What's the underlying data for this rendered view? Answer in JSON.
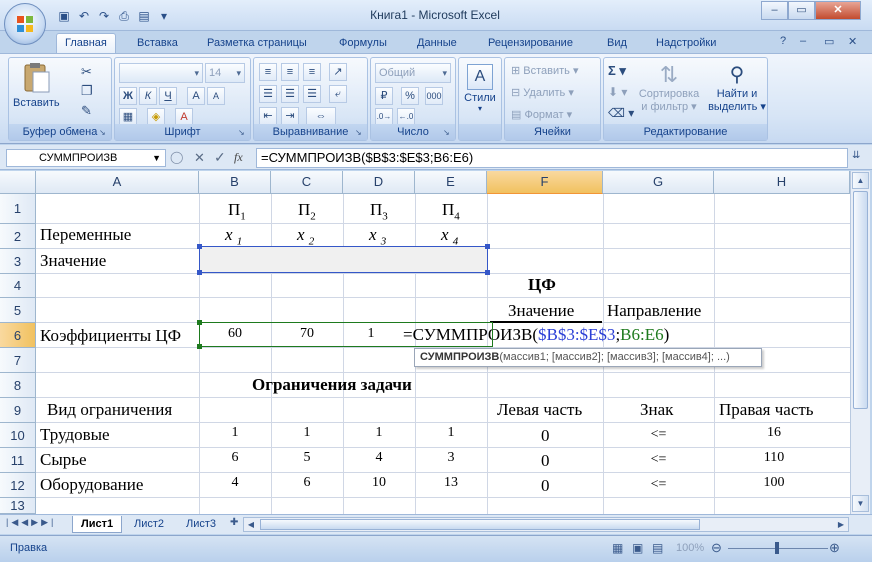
{
  "window": {
    "title": "Книга1 - Microsoft Excel"
  },
  "tabs": [
    "Главная",
    "Вставка",
    "Разметка страницы",
    "Формулы",
    "Данные",
    "Рецензирование",
    "Вид",
    "Надстройки"
  ],
  "ribbon": {
    "clipboard": {
      "label": "Буфер обмена",
      "paste": "Вставить"
    },
    "font": {
      "label": "Шрифт",
      "size": "14",
      "bold": "Ж",
      "italic": "К",
      "underline": "Ч"
    },
    "alignment": {
      "label": "Выравнивание"
    },
    "number": {
      "label": "Число",
      "format": "Общий"
    },
    "styles": {
      "label": "Стили"
    },
    "cells": {
      "label": "Ячейки",
      "insert": "Вставить",
      "delete": "Удалить",
      "format": "Формат"
    },
    "editing": {
      "label": "Редактирование",
      "sort": "Сортировка",
      "sort2": "и фильтр",
      "find": "Найти и",
      "find2": "выделить"
    }
  },
  "formula_bar": {
    "name_box": "СУММПРОИЗВ",
    "fx": "fx",
    "formula": "=СУММПРОИЗВ($B$3:$E$3;B6:E6)"
  },
  "columns": [
    "A",
    "B",
    "C",
    "D",
    "E",
    "F",
    "G",
    "H"
  ],
  "rows": [
    "1",
    "2",
    "3",
    "4",
    "5",
    "6",
    "7",
    "8",
    "9",
    "10",
    "11",
    "12",
    "13"
  ],
  "cells": {
    "B1": "П",
    "B1s": "1",
    "C1": "П",
    "C1s": "2",
    "D1": "П",
    "D1s": "3",
    "E1": "П",
    "E1s": "4",
    "A2": "Переменные",
    "B2": "x",
    "B2s": "1",
    "C2": "x",
    "C2s": "2",
    "D2": "x",
    "D2s": "3",
    "E2": "x",
    "E2s": "4",
    "A3": "Значение",
    "F4": "ЦФ",
    "F5": "Значение",
    "G5": "Направление",
    "A6": "Коэффициенты ЦФ",
    "B6": "60",
    "C6": "70",
    "D6": "1",
    "F6_prefix": "=СУММПРОИЗВ(",
    "F6_range1": "$B$3:$E$3",
    "F6_sep": ";",
    "F6_range2": "B6:E6",
    "F6_suffix": ")",
    "D8": "Ограничения задачи",
    "A9": "Вид ограничения",
    "F9": "Левая часть",
    "G9": "Знак",
    "H9": "Правая часть",
    "A10": "Трудовые",
    "B10": "1",
    "C10": "1",
    "D10": "1",
    "E10": "1",
    "F10": "0",
    "G10": "<=",
    "H10": "16",
    "A11": "Сырье",
    "B11": "6",
    "C11": "5",
    "D11": "4",
    "E11": "3",
    "F11": "0",
    "G11": "<=",
    "H11": "110",
    "A12": "Оборудование",
    "B12": "4",
    "C12": "6",
    "D12": "10",
    "E12": "13",
    "F12": "0",
    "G12": "<=",
    "H12": "100"
  },
  "tooltip": {
    "func": "СУММПРОИЗВ",
    "args": "(массив1; [массив2]; [массив3]; [массив4]; ...)"
  },
  "sheets": [
    "Лист1",
    "Лист2",
    "Лист3"
  ],
  "status": {
    "mode": "Правка",
    "zoom": "100%"
  },
  "colors": {
    "range1": "#2b3fd6",
    "range2": "#1e7a1e"
  }
}
